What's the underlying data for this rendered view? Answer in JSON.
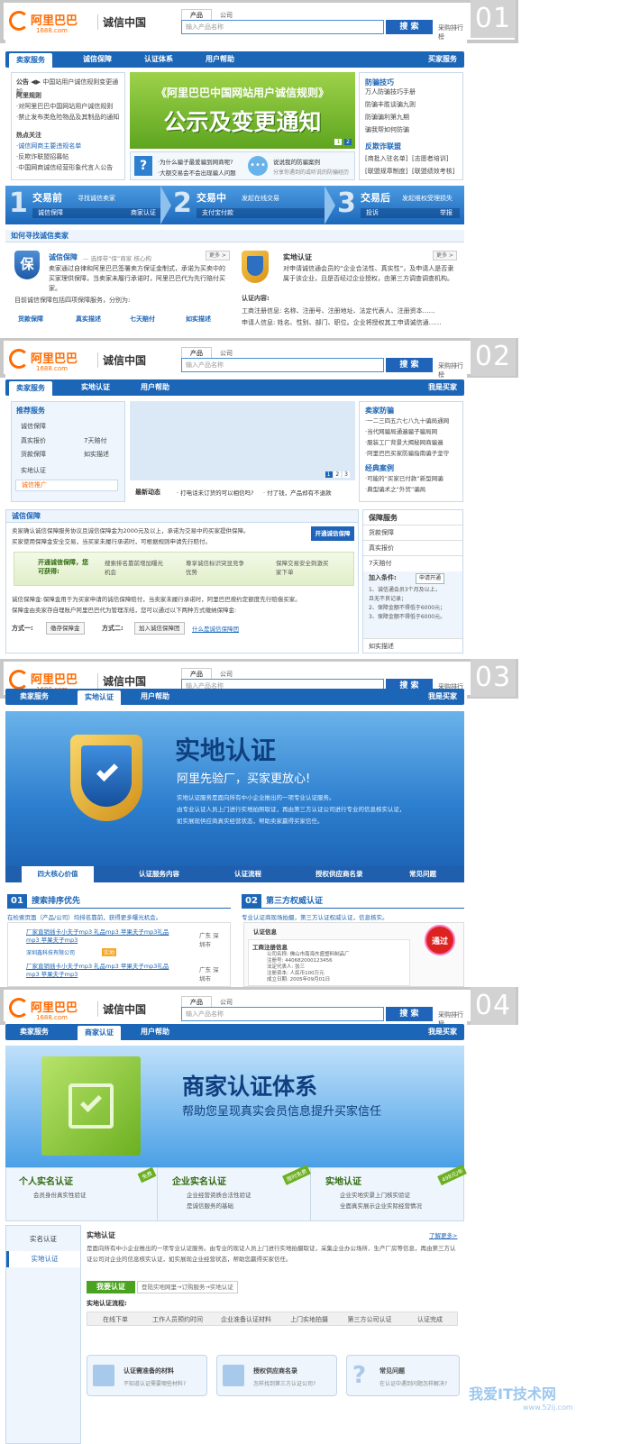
{
  "header": {
    "logo_name": "阿里巴巴",
    "logo_domain": "1688.com",
    "brand": "诚信中国",
    "search_tab_product": "产品",
    "search_tab_company": "公司",
    "search_placeholder": "输入产品名称",
    "search_button": "搜 索",
    "rank_link": "采购排行榜"
  },
  "badges": [
    "01",
    "02",
    "03",
    "04"
  ],
  "p1": {
    "nav": [
      "卖家服务",
      "诚信保障",
      "认证体系",
      "用户帮助"
    ],
    "nav_right": "买家服务",
    "notice_label": "公告",
    "notice_items": [
      "中国站用户诚信规则变更通知",
      "阿里规则",
      "·对阿里巴巴中国网站用户诚信规则",
      "·禁止发布类危险物品及其制品的通知"
    ],
    "hot_title": "热点关注",
    "hot_items": [
      "·诚信网商主要违规名单",
      "·反欺诈联盟招募帖",
      "·中国网商诚信经营形象代言人公告"
    ],
    "banner_title": "《阿里巴巴中国网站用户诚信规则》",
    "banner_big": "公示及变更通知",
    "banner_pages": [
      "1",
      "2"
    ],
    "qa1": "·为什么骗子最爱骗到网商呢?",
    "qa2": "·大额交易会不会出现骗人问题",
    "qa3": "说说我的防骗案例",
    "qa4": "分享你遇到的或听说的防骗经历",
    "right_title": "防骗技巧",
    "right_items": [
      "万人防骗技巧手册",
      "防骗丰胜谈骗九则",
      "防骗骗利第九期",
      "骗我帮如何防骗"
    ],
    "report_title": "反欺诈联盟",
    "report_items": [
      "[商批入驻名单]",
      "[志愿者培训]",
      "[联盟规章制度]",
      "[联盟绩效考核]"
    ],
    "steps": [
      {
        "num": "1",
        "title": "交易前",
        "desc": "寻找诚信卖家",
        "sub1": "诚信保障",
        "sub2": "商家认证"
      },
      {
        "num": "2",
        "title": "交易中",
        "desc": "发起在线交易",
        "sub1": "支付宝付款",
        "sub2": ""
      },
      {
        "num": "3",
        "title": "交易后",
        "desc": "发起维权受理损失",
        "sub1": "投诉",
        "sub2": "举报"
      }
    ],
    "section_title": "如何寻找诚信卖家",
    "card1_title": "诚信保障",
    "card1_desc": "— 选择带“保”商家  核心构",
    "card1_more": "更多 >",
    "card1_text": "卖家通过自律和阿里巴巴签署卖方保证金制式，承诺为买卖中的买家理供保障，当卖家未履行承诺时，阿里巴巴代为先行赔付买家。",
    "card1_note": "目前诚信保障包括四项保障服务，分别为:",
    "card1_icon_text": "保",
    "badges4": [
      "货款保障",
      "真实描述",
      "七天赔付",
      "如实描述"
    ],
    "card2_title": "实地认证",
    "card2_more": "更多 >",
    "card2_text": "对申请诚信通会员的“企业合法性、真实性”，及申请人是否隶属于该企业，且是否经过企业授权，由第三方调查调查机构。",
    "card2_content_label": "认证内容:",
    "card2_line1": "工商注册信息: 名称、注册号、注册地址、法定代表人、注册资本……",
    "card2_line2": "申请人信息: 姓名、性别、部门、职位。企业将授权其工申请诚信通……"
  },
  "p2": {
    "nav": [
      "卖家服务",
      "实地认证",
      "用户帮助"
    ],
    "nav_right": "我是买家",
    "rec_title": "推荐服务",
    "rec_items": [
      "诚信保障",
      "真实报价",
      "7天赔付",
      "货款保障",
      "如实描述",
      "实地认证",
      "诚信推广"
    ],
    "dyn_label": "最新动态",
    "dyn_items": [
      "· 打电话未订货的可以相信吗?",
      "· 付了钱，产品却有不退款"
    ],
    "pages": [
      "1",
      "2",
      "3"
    ],
    "right_title": "卖家防骗",
    "right_items": [
      "·一二三四五六七八九十骗局通网",
      "·当代网骗局通遍骗子骗局网",
      "·服装工厂背景大揭秘网商骗遍",
      "·阿里巴巴买家防骗指南骗子坚守"
    ],
    "case_title": "经典案例",
    "case_items": [
      "·可能的“买家已付款”新型网骗",
      "·典型骗术之“外贸”骗局"
    ],
    "guar_title": "诚信保障",
    "guar_text1": "卖家确认诚信保障服务协议且诚信保障金为2000元及以上，承诺为交易中的买家提供保障。",
    "guar_text2": "买家使用保障金安全交易，当买家未履行承诺时，可根据规则申请先行赔付。",
    "guar_btn": "开通诚信保障",
    "flow": [
      "开通诚信保障，您可获得:",
      "搜索排名靠前增加曝光机会",
      "尊享诚信标识突显竞争优势",
      "保障交易安全刺激买家下单"
    ],
    "guar_line1": "诚信保障金:保障金用于为买家申请的诚信保障赔付，当卖家未履行承诺时，阿里巴巴按约定额度先行赔偿买家。",
    "guar_line2": "保障金由卖家存自理账户阿里巴巴代为管理冻结，您可以通过以下两种方式缴纳保障金:",
    "way1": "方式一:",
    "way1_btn": "缴存保障金",
    "way2": "方式二:",
    "way2_btn": "加入诚信保障团",
    "way_link": "什么是诚信保障团",
    "svc_title": "保障服务",
    "svc_items": [
      "货款保障",
      "真实报价",
      "7天赔付"
    ],
    "join_label": "加入条件:",
    "join_btn": "申请开通",
    "join_items": [
      "1、诚信通会员3个月及以上，",
      "且无不良记录；",
      "2、保障金额不得低于6000元；",
      "3、保障金额不得低于6000元。"
    ],
    "svc_last": "如实描述"
  },
  "p3": {
    "nav": [
      "卖家服务",
      "实地认证",
      "用户帮助"
    ],
    "nav_right": "我是买家",
    "hero_title": "实地认证",
    "hero_sub": "阿里先验厂，买家更放心!",
    "hero_text": [
      "实地认证服务是面向所有中小企业推出的一项专业认证服务。",
      "由专业认证人员上门进行实地拍照取证，再由第三方认证公司进行专业的信息核实认证，",
      "如实展现供应商真实经营状态，帮助卖家赢得买家信任。"
    ],
    "tabs": [
      "四大核心价值",
      "认证服务内容",
      "认证流程",
      "授权供应商名录",
      "常见问题"
    ],
    "s1_num": "01",
    "s1_title": "搜索排序优先",
    "s1_desc": "在检索页面（产品/公司）均排名靠前，获得更多曝光机会。",
    "s1_item1": "厂家直销插卡小夫子mp3 礼品mp3 苹果夫子mp3礼品mp3 苹果夫子mp3",
    "s1_item1_loc": "广东 深圳市",
    "s1_item1_co": "深圳鑫科技有限公司",
    "s1_item2": "厂家直销插卡小夫子mp3 礼品mp3 苹果夫子mp3礼品mp3 苹果夫子mp3",
    "s1_item2_loc": "广东 深圳市",
    "s1_tag": "实地",
    "s2_num": "02",
    "s2_title": "第三方权威认证",
    "s2_desc": "专业认证商现场拍摄，第三方认证权威认证，信息核实。",
    "s2_cert_title": "认证信息",
    "s2_reg": "工商注册信息",
    "s2_rows": [
      "公司名称: 佛山市南海东盛塑料制品厂",
      "注册号: 440682000123456",
      "法定代表人: 张三",
      "注册资本: 人民币100万元",
      "成立日期: 2005年09月01日"
    ],
    "s2_stamp": "通过"
  },
  "p4": {
    "nav": [
      "卖家服务",
      "商家认证",
      "用户帮助"
    ],
    "nav_right": "我是买家",
    "hero_title": "商家认证体系",
    "hero_sub": "帮助您呈现真实会员信息提升买家信任",
    "cards": [
      {
        "title": "个人实名认证",
        "items": [
          "会员身份真实性验证"
        ],
        "tag": "免费"
      },
      {
        "title": "企业实名认证",
        "items": [
          "企业经营资质合法性验证",
          "是诚信服务的基础"
        ],
        "tag": "限时免费"
      },
      {
        "title": "实地认证",
        "items": [
          "企业实地实景上门核实验证",
          "全面真实展示企业实际经营情况"
        ],
        "tag": "498元/年"
      }
    ],
    "side": [
      "实名认证",
      "实地认证"
    ],
    "field_title": "实地认证",
    "field_more": "了解更多>",
    "field_text": "是面向所有中小企业推出的一项专业认证服务。由专业的现证人员上门进行实地拍摄取证，采集企业办公场所、生产厂房等信息，再由第三方认证公司对企业的信息核实认证，如实展现企业经营状态，帮助您赢得买家信任。",
    "apply_btn": "我要认证",
    "apply_flow": "登陆实地网里→订购服务→实地认证",
    "process_label": "实地认证流程:",
    "process": [
      "在线下单",
      "工作人员预约时间",
      "企业准备认证材料",
      "上门实地拍摄",
      "第三方公司认证",
      "认证完成"
    ],
    "bottom": [
      {
        "title": "认证需准备的材料",
        "sub": "不知道认证需要哪些材料?"
      },
      {
        "title": "授权供应商名录",
        "sub": "怎样找到第三方认证公司?"
      },
      {
        "title": "常见问题",
        "sub": "在认证中遇到问题怎样解决?"
      }
    ],
    "watermark": "我爱IT技术网",
    "watermark_url": "www.52ij.com"
  }
}
